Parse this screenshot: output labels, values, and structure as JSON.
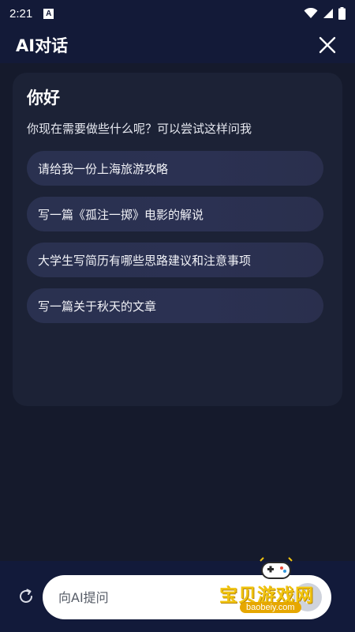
{
  "status_bar": {
    "time": "2:21",
    "notification_badge": "A"
  },
  "header": {
    "title": "AI对话"
  },
  "greeting": {
    "title": "你好",
    "subtitle": "你现在需要做些什么呢？可以尝试这样问我"
  },
  "suggestions": [
    {
      "label": "请给我一份上海旅游攻略"
    },
    {
      "label": "写一篇《孤注一掷》电影的解说"
    },
    {
      "label": "大学生写简历有哪些思路建议和注意事项"
    },
    {
      "label": "写一篇关于秋天的文章"
    }
  ],
  "input": {
    "placeholder": "向AI提问"
  },
  "watermark": {
    "text": "宝贝游戏网",
    "url": "baobeiy.com"
  },
  "colors": {
    "background": "#141a2e",
    "header": "#131a38",
    "card": "#1c2236",
    "suggestion": "#2a3150",
    "bottom_bar": "#121a3a"
  }
}
